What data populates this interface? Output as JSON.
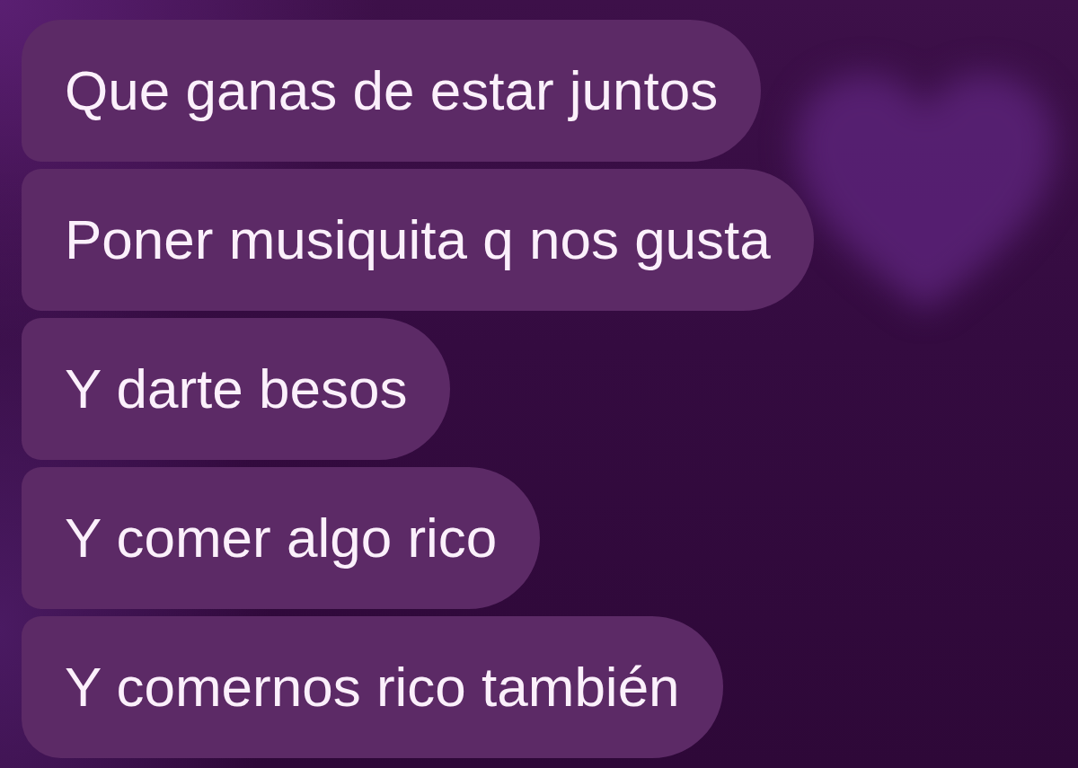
{
  "messages": [
    {
      "text": "Que ganas de estar juntos"
    },
    {
      "text": "Poner musiquita q nos gusta"
    },
    {
      "text": "Y darte besos"
    },
    {
      "text": "Y comer algo rico"
    },
    {
      "text": "Y comernos rico también"
    }
  ]
}
